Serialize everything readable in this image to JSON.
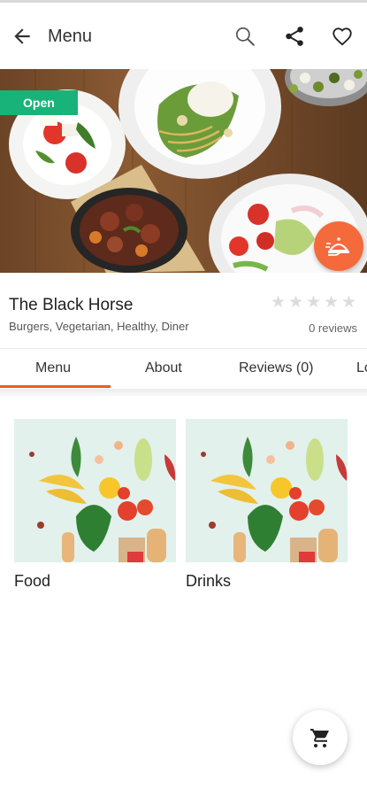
{
  "appbar": {
    "title": "Menu",
    "icons": [
      "arrow-back-icon",
      "search-icon",
      "share-icon",
      "heart-icon"
    ]
  },
  "hero": {
    "status_badge": "Open",
    "colors": {
      "badge": "#18b378",
      "delivery_fab": "#f46a3a"
    }
  },
  "restaurant": {
    "name": "The Black Horse",
    "categories": "Burgers, Vegetarian, Healthy, Diner",
    "rating": 0,
    "rating_max": 5,
    "reviews": "0 reviews"
  },
  "tabs": [
    {
      "label": "Menu",
      "active": true
    },
    {
      "label": "About",
      "active": false
    },
    {
      "label": "Reviews (0)",
      "active": false
    },
    {
      "label": "Lo",
      "active": false
    }
  ],
  "menu_categories": [
    {
      "label": "Food"
    },
    {
      "label": "Drinks"
    }
  ],
  "accent_color": "#f05a22"
}
